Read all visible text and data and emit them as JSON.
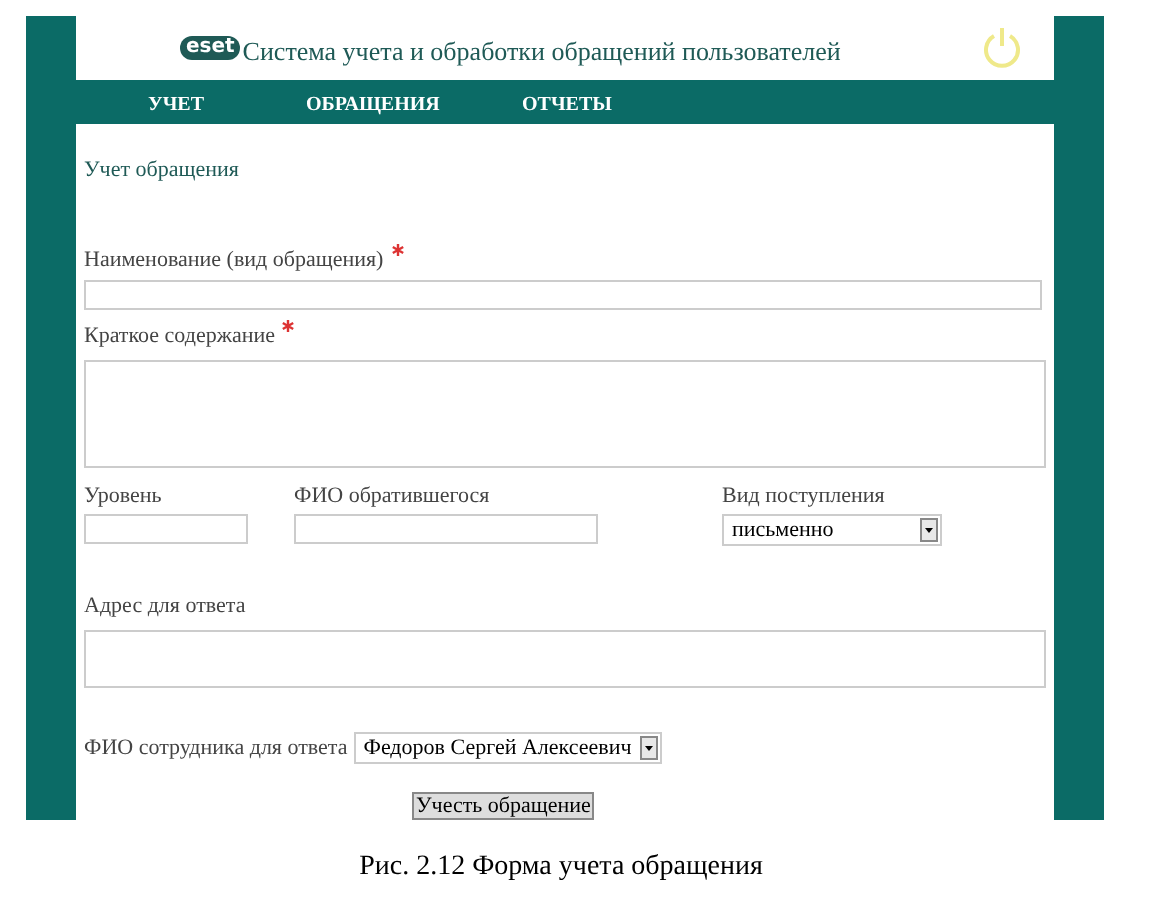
{
  "header": {
    "logo": "eset",
    "title": "Система учета и обработки обращений пользователей"
  },
  "nav": [
    {
      "label": "УЧЕТ"
    },
    {
      "label": "ОБРАЩЕНИЯ"
    },
    {
      "label": "ОТЧЕТЫ"
    }
  ],
  "section_title": "Учет обращения",
  "name_field": {
    "label": "Наименование (вид обращения)",
    "required": true
  },
  "summary_field": {
    "label": "Краткое содержание",
    "required": true
  },
  "row_fields": [
    {
      "label": "Уровень",
      "kind": "text"
    },
    {
      "label": "ФИО обратившегося",
      "kind": "text"
    },
    {
      "label": "Вид поступления",
      "kind": "select",
      "value": "письменно"
    }
  ],
  "address_field": {
    "label": "Адрес для ответа"
  },
  "employee_field": {
    "label": "ФИО сотрудника для ответа",
    "value": "Федоров Сергей Алексеевич"
  },
  "submit_button": "Учесть обращение",
  "caption": "Рис.  2.12 Форма учета обращения"
}
